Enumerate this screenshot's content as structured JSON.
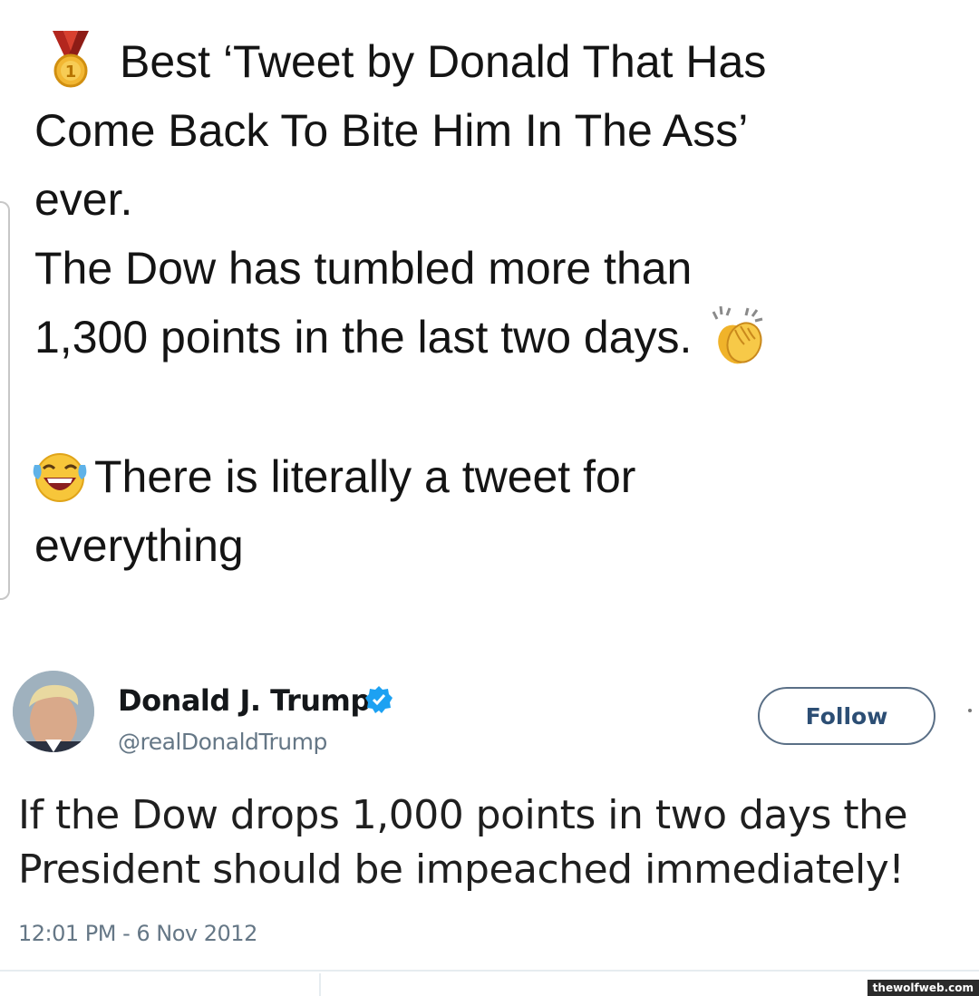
{
  "post": {
    "line1": "Best ‘Tweet by Donald That Has",
    "line2": "Come Back To Bite Him In The Ass’",
    "line3": "ever.",
    "line4": "The Dow has tumbled more than",
    "line5": "1,300 points in the last two days.",
    "line6": "There is literally a tweet for",
    "line7": "everything",
    "medal_number": "1",
    "icons": [
      "medal-icon",
      "clapping-hands-icon",
      "tears-of-joy-icon"
    ]
  },
  "tweet": {
    "display_name": "Donald J. Trump",
    "handle": "@realDonaldTrump",
    "follow_label": "Follow",
    "text_line1": "If the Dow drops 1,000 points in two days the",
    "text_line2": "President should be impeached immediately!",
    "timestamp": "12:01 PM - 6 Nov 2012",
    "verified_color": "#1da1f2"
  },
  "watermark": "thewolfweb.com"
}
